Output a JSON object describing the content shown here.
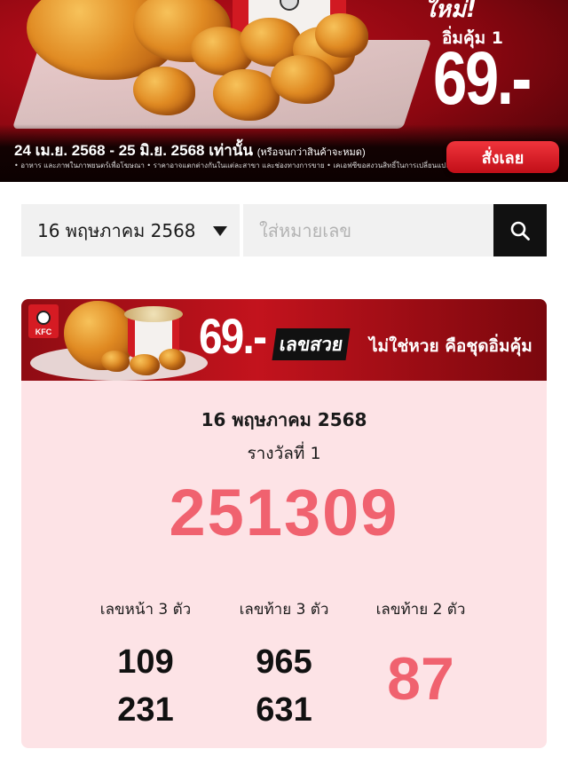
{
  "promo": {
    "new_label": "ใหม่!",
    "subtitle": "อิ่มคุ้ม 1",
    "price": "69.-",
    "date_range": "24 เม.ย. 2568 - 25 มิ.ย. 2568 เท่านั้น",
    "date_note": "(หรือจนกว่าสินค้าจะหมด)",
    "fine_print": "• อาหาร และภาพในภาพยนตร์เพื่อโฆษณา • ราคาอาจแตกต่างกันในแต่ละสาขา และช่องทางการขาย • เคเอฟซีขอสงวนสิทธิ์ในการเปลี่ยนแปลง",
    "order_button": "สั่งเลย"
  },
  "search": {
    "selected_date": "16 พฤษภาคม 2568",
    "placeholder": "ใส่หมายเลข"
  },
  "ad_banner": {
    "logo_text": "KFC",
    "price": "69.-",
    "highlight": "เลขสวย",
    "text": "ไม่ใช่หวย คือชุดอิ่มคุ้ม"
  },
  "result": {
    "draw_date": "16 พฤษภาคม 2568",
    "first_prize_label": "รางวัลที่ 1",
    "first_prize": "251309",
    "front3": {
      "label": "เลขหน้า 3 ตัว",
      "numbers": [
        "109",
        "231"
      ]
    },
    "back3": {
      "label": "เลขท้าย 3 ตัว",
      "numbers": [
        "965",
        "631"
      ]
    },
    "back2": {
      "label": "เลขท้าย 2 ตัว",
      "number": "87"
    }
  },
  "colors": {
    "brand_red": "#c8101e",
    "prize_pink": "#f0626f",
    "card_bg": "#fde3e6"
  }
}
